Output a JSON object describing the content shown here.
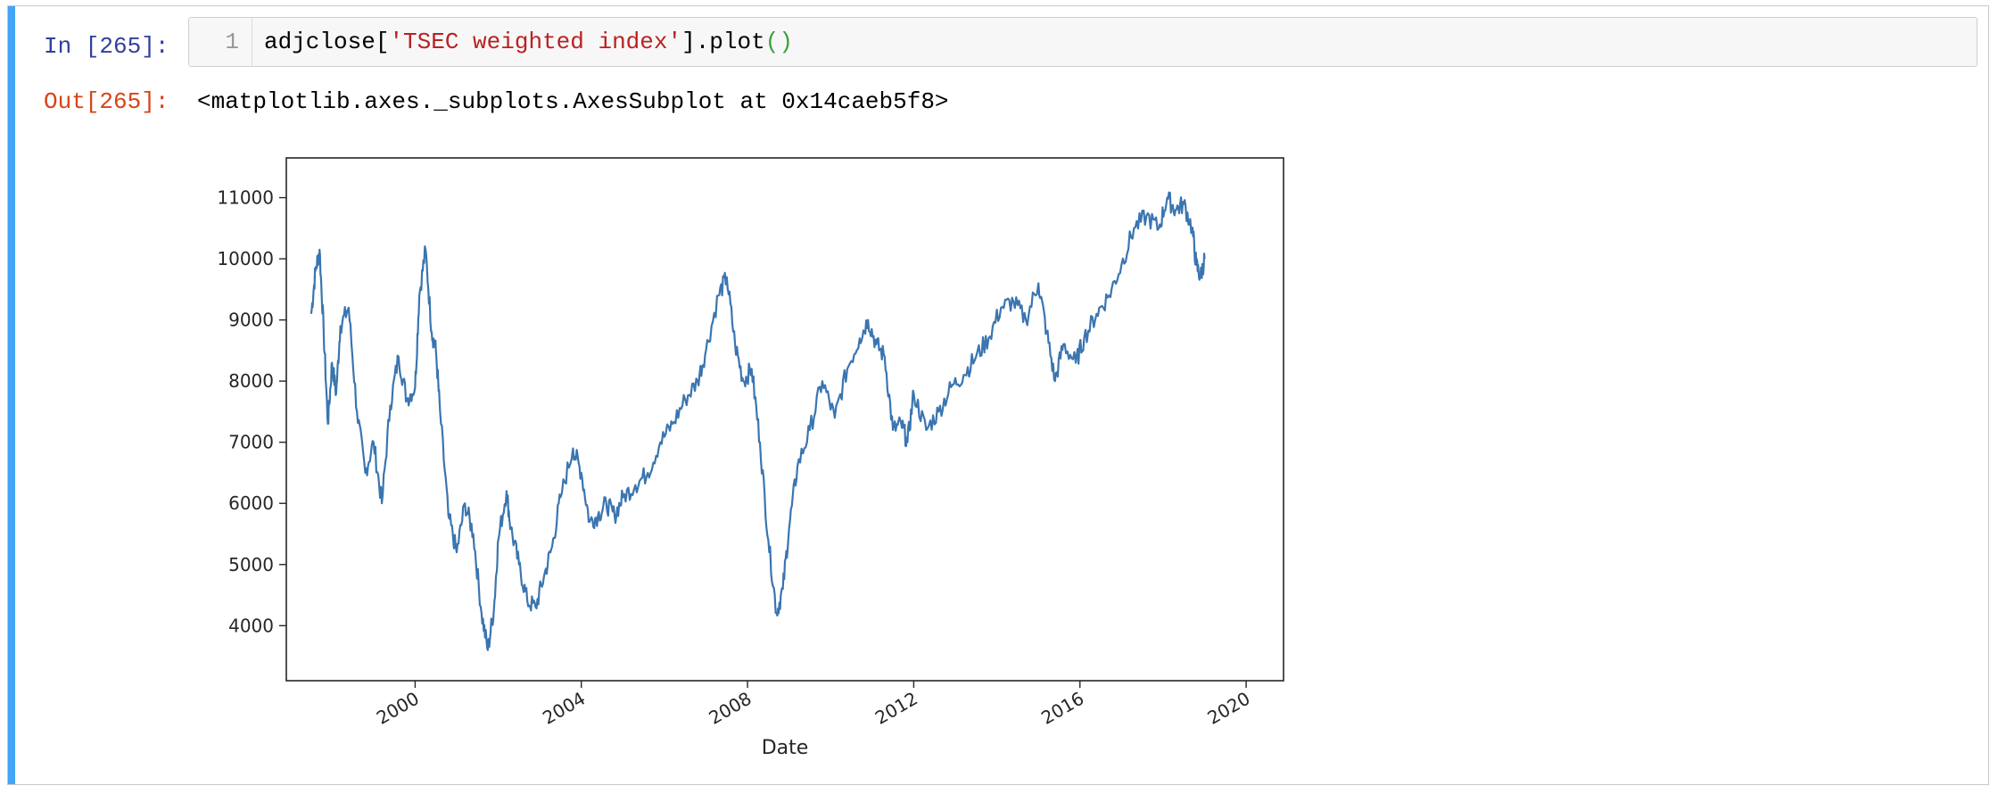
{
  "cell": {
    "in_prompt": "In [265]:",
    "out_prompt": "Out[265]:",
    "line_number": "1",
    "code": {
      "prefix": "adjclose[",
      "string": "'TSEC weighted index'",
      "suffix": "].plot",
      "parens": "()"
    },
    "output_text": "<matplotlib.axes._subplots.AxesSubplot at 0x14caeb5f8>",
    "accent_color": "#42a5f5"
  },
  "chart_data": {
    "type": "line",
    "xlabel": "Date",
    "ylabel": "",
    "xlim": [
      1996.9,
      2020.9
    ],
    "ylim": [
      3100,
      11650
    ],
    "x_ticks": [
      2000,
      2004,
      2008,
      2012,
      2016,
      2020
    ],
    "x_tick_labels": [
      "2000",
      "2004",
      "2008",
      "2012",
      "2016",
      "2020"
    ],
    "y_ticks": [
      4000,
      5000,
      6000,
      7000,
      8000,
      9000,
      10000,
      11000
    ],
    "y_tick_labels": [
      "4000",
      "5000",
      "6000",
      "7000",
      "8000",
      "9000",
      "10000",
      "11000"
    ],
    "line_color": "#3a75b0",
    "grid": false,
    "series": [
      {
        "name": "",
        "x": [
          1997.5,
          1997.6,
          1997.7,
          1997.8,
          1997.9,
          1998.0,
          1998.1,
          1998.2,
          1998.4,
          1998.6,
          1998.8,
          1999.0,
          1999.2,
          1999.4,
          1999.6,
          1999.8,
          2000.0,
          2000.1,
          2000.25,
          2000.4,
          2000.5,
          2000.6,
          2000.8,
          2001.0,
          2001.2,
          2001.4,
          2001.6,
          2001.75,
          2001.9,
          2002.0,
          2002.2,
          2002.3,
          2002.5,
          2002.7,
          2002.9,
          2003.1,
          2003.3,
          2003.5,
          2003.8,
          2004.0,
          2004.2,
          2004.4,
          2004.6,
          2004.8,
          2005.0,
          2005.3,
          2005.6,
          2005.9,
          2006.2,
          2006.5,
          2006.8,
          2007.0,
          2007.3,
          2007.5,
          2007.7,
          2007.9,
          2008.1,
          2008.3,
          2008.5,
          2008.7,
          2008.85,
          2009.0,
          2009.2,
          2009.5,
          2009.8,
          2010.1,
          2010.4,
          2010.7,
          2010.9,
          2011.1,
          2011.3,
          2011.5,
          2011.7,
          2011.85,
          2012.0,
          2012.3,
          2012.6,
          2012.9,
          2013.2,
          2013.5,
          2013.8,
          2014.1,
          2014.4,
          2014.7,
          2015.0,
          2015.2,
          2015.4,
          2015.6,
          2015.9,
          2016.1,
          2016.4,
          2016.7,
          2017.0,
          2017.3,
          2017.6,
          2017.9,
          2018.1,
          2018.3,
          2018.5,
          2018.7,
          2018.8,
          2018.9,
          2019.0
        ],
        "values": [
          9100,
          9800,
          10150,
          8800,
          7300,
          8300,
          7800,
          8900,
          9200,
          7500,
          6500,
          7000,
          6000,
          7600,
          8400,
          7700,
          7900,
          9400,
          10150,
          8800,
          8500,
          7500,
          5800,
          5200,
          6000,
          5500,
          4200,
          3600,
          4300,
          5400,
          6200,
          5600,
          5000,
          4400,
          4300,
          4800,
          5300,
          6100,
          6900,
          6500,
          5700,
          5800,
          6000,
          5800,
          6100,
          6300,
          6500,
          7000,
          7300,
          7700,
          8000,
          8500,
          9400,
          9700,
          8600,
          8000,
          8200,
          7000,
          5400,
          4200,
          4600,
          5600,
          6600,
          7200,
          8000,
          7400,
          8200,
          8700,
          9000,
          8600,
          8400,
          7200,
          7300,
          7000,
          7800,
          7200,
          7500,
          7900,
          8100,
          8400,
          8700,
          9200,
          9300,
          9000,
          9600,
          8800,
          8000,
          8600,
          8300,
          8700,
          9100,
          9400,
          9900,
          10500,
          10700,
          10500,
          11000,
          10800,
          10900,
          10500,
          9900,
          9700,
          10000
        ]
      }
    ]
  }
}
